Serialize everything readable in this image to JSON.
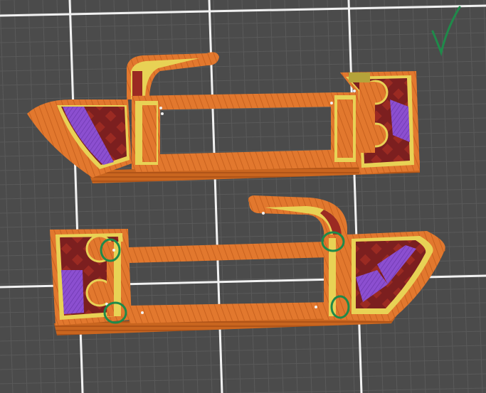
{
  "scene": {
    "colors": {
      "bed_background": "#4b4b4b",
      "bed_grid_minor": "#5a5a5a",
      "bed_grid_major": "#f2f2f2",
      "perimeter_orange": "#e2782e",
      "perimeter_orange_dark": "#b8561c",
      "perimeter_orange_light": "#f08b3a",
      "external_perimeter_yellow": "#e8d255",
      "infill_dark_red": "#7c1f1f",
      "infill_red": "#9b2a22",
      "solid_infill_purple": "#8c4fd0",
      "gap_fill_olive": "#b5a33a",
      "annotation_green": "#1f8a4a"
    },
    "annotations": {
      "checkmark": "checkmark-icon",
      "circle_count": 4
    }
  }
}
